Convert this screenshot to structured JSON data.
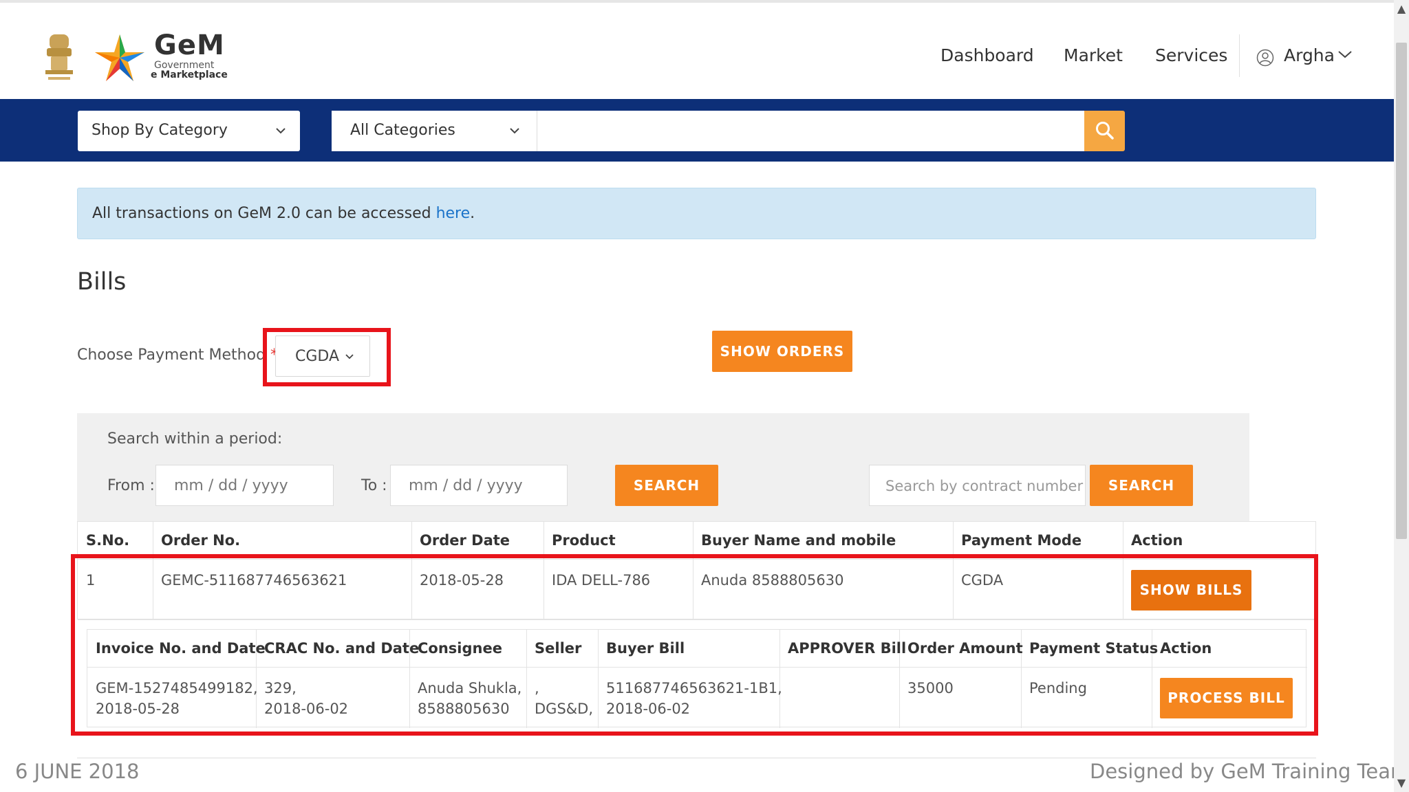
{
  "header": {
    "logo_title": "GeM",
    "logo_subtitle_1": "Government",
    "logo_subtitle_2": "e Marketplace",
    "nav": [
      "Dashboard",
      "Market",
      "Services"
    ],
    "user_name": "Argha"
  },
  "searchbar": {
    "shop_by_category": "Shop By Category",
    "all_categories": "All Categories",
    "query": ""
  },
  "alert": {
    "text": "All transactions on GeM 2.0 can be accessed ",
    "link": "here",
    "suffix": "."
  },
  "page": {
    "title": "Bills",
    "payment_method_label": "Choose Payment Method",
    "required_mark": "*",
    "payment_method_value": "CGDA",
    "show_orders_label": "SHOW ORDERS"
  },
  "period": {
    "label": "Search within a period:",
    "from_label": "From :",
    "from_placeholder": "mm / dd / yyyy",
    "to_label": "To :",
    "to_placeholder": "mm / dd / yyyy",
    "search_label": "SEARCH",
    "contract_placeholder": "Search by contract number",
    "contract_search_label": "SEARCH"
  },
  "orders_table": {
    "headers": [
      "S.No.",
      "Order No.",
      "Order Date",
      "Product",
      "Buyer Name and mobile",
      "Payment Mode",
      "Action"
    ],
    "rows": [
      {
        "sno": "1",
        "order_no": "GEMC-511687746563621",
        "order_date": "2018-05-28",
        "product": "IDA DELL-786",
        "buyer": "Anuda 8588805630",
        "payment_mode": "CGDA",
        "action_label": "SHOW BILLS"
      }
    ]
  },
  "bills_table": {
    "headers": [
      "Invoice No. and Date",
      "CRAC No. and Date",
      "Consignee",
      "Seller",
      "Buyer Bill",
      "APPROVER Bill",
      "Order Amount",
      "Payment Status",
      "Action"
    ],
    "rows": [
      {
        "invoice_no": "GEM-1527485499182,",
        "invoice_date": "2018-05-28",
        "crac_no": "329,",
        "crac_date": "2018-06-02",
        "consignee_name": "Anuda Shukla,",
        "consignee_mobile": "8588805630",
        "seller_1": ",",
        "seller_2": "DGS&D,",
        "buyer_bill_no": "511687746563621-1B1,",
        "buyer_bill_date": "2018-06-02",
        "approver_bill": "",
        "order_amount": "35000",
        "payment_status": "Pending",
        "action_label": "PROCESS BILL"
      }
    ]
  },
  "footer": {
    "date": "6 JUNE 2018",
    "credit": "Designed by GeM Training Team"
  },
  "colors": {
    "navy": "#0d2f78",
    "orange": "#f5861f",
    "dark_orange": "#e8710f",
    "highlight_red": "#e8141b",
    "alert_bg": "#d1e7f5",
    "link_blue": "#1a73c9"
  },
  "icons": [
    "national-emblem-icon",
    "gem-star-icon",
    "user-circle-icon",
    "chevron-down-icon",
    "search-icon"
  ]
}
